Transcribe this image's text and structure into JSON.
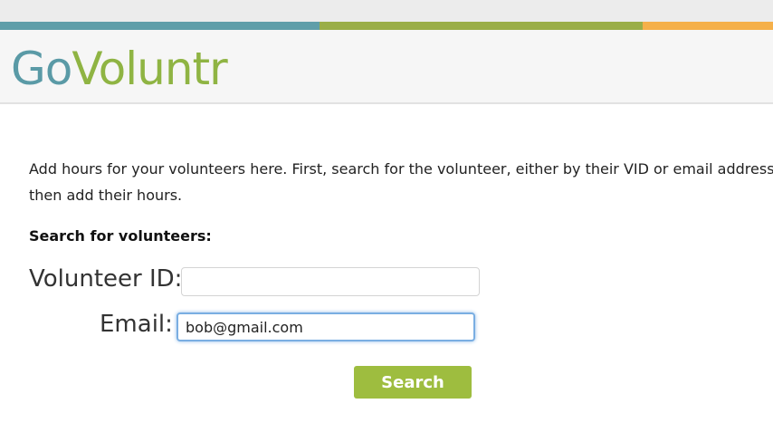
{
  "brand": {
    "logo_part1": "Go",
    "logo_part2": "Voluntr",
    "colors": {
      "teal": "#5a9aa6",
      "green": "#8fb443",
      "orange": "#f5b04a",
      "button": "#9ebd3f"
    }
  },
  "color_bar": [
    {
      "color": "#5f9ea9"
    },
    {
      "color": "#9aae48"
    },
    {
      "color": "#f5b04a"
    }
  ],
  "main": {
    "intro_text": "Add hours for your volunteers here. First, search for the volunteer, either by their VID or email address, then add their hours.",
    "section_title": "Search for volunteers:",
    "form": {
      "vid_label": "Volunteer ID:",
      "vid_value": "",
      "email_label": "Email:",
      "email_value": "bob@gmail.com",
      "search_label": "Search"
    }
  }
}
